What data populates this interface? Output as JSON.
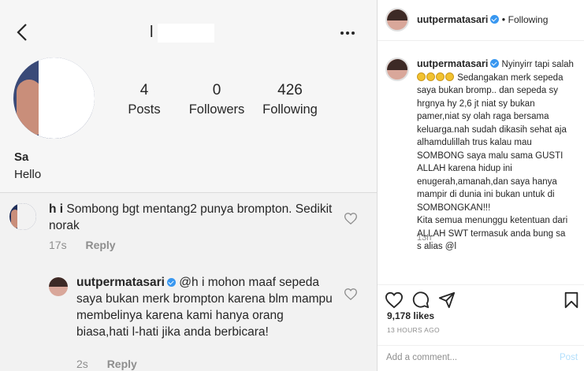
{
  "left": {
    "top_username": "l    ai",
    "stats": [
      {
        "num": "4",
        "label": "Posts"
      },
      {
        "num": "0",
        "label": "Followers"
      },
      {
        "num": "426",
        "label": "Following"
      }
    ],
    "profile_name": "Sa          s",
    "bio": "Hello",
    "comments": [
      {
        "user": "h     i",
        "text": "Sombong bgt mentang2 punya brompton. Sedikit norak",
        "time": "17s",
        "reply": "Reply"
      },
      {
        "user": "uutpermatasari",
        "mention": "@h        i",
        "text": "mohon maaf sepeda saya bukan merk brompton karena blm mampu membelinya karena kami hanya orang biasa,hati l-hati jika anda berbicara!",
        "time": "2s",
        "reply": "Reply"
      }
    ]
  },
  "right": {
    "username": "uutpermatasari",
    "separator": "•",
    "follow_status": "Following",
    "caption_first": "Nyinyirr tapi salah",
    "caption_rest": "Sedangakan merk sepeda saya bukan bromp.. dan sepeda sy hrgnya hy 2,6 jt niat sy bukan pamer,niat sy olah raga bersama keluarga.nah sudah dikasih sehat aja alhamdulillah trus kalau mau SOMBONG saya malu sama GUSTI ALLAH karena hidup ini enugerah,amanah,dan saya hanya mampir di dunia ini bukan untuk di SOMBONGKAN!!!\nKita semua menunggu ketentuan dari ALLAH SWT termasuk anda bung sa               s alias @l",
    "caption_time": "13h",
    "likes": "9,178 likes",
    "time_ago": "13 HOURS AGO",
    "comment_placeholder": "Add a comment...",
    "post_label": "Post"
  },
  "colors": {
    "verified": "#3897f0",
    "post_disabled": "#b2dffc",
    "muted": "#8e8e8e"
  }
}
